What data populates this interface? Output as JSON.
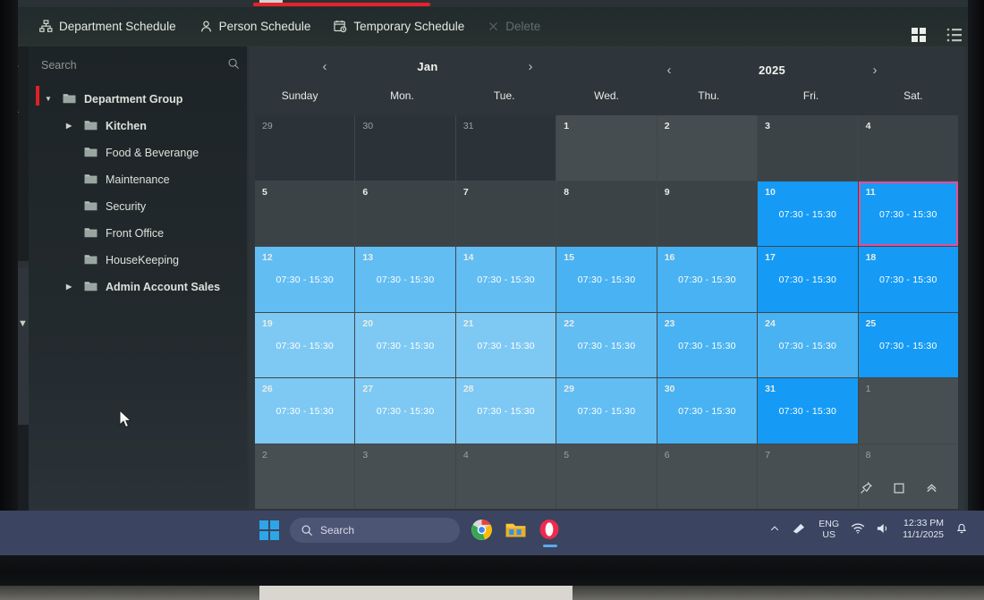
{
  "app": {
    "tabs": [
      {
        "label": "Department Schedule",
        "icon": "org-chart-icon",
        "state": "active"
      },
      {
        "label": "Person Schedule",
        "icon": "person-icon",
        "state": "normal"
      },
      {
        "label": "Temporary Schedule",
        "icon": "calendar-clock-icon",
        "state": "normal"
      },
      {
        "label": "Delete",
        "icon": "close-x-icon",
        "state": "disabled"
      }
    ],
    "view_toggles": [
      {
        "name": "grid-view-icon",
        "active": true
      },
      {
        "name": "list-view-icon",
        "active": false
      }
    ]
  },
  "sidebar": {
    "search": {
      "placeholder": "Search",
      "value": "",
      "icon": "search-icon"
    },
    "tree": [
      {
        "label": "Department Group",
        "level": 0,
        "expanded": true,
        "bold": true,
        "selected": true
      },
      {
        "label": "Kitchen",
        "level": 1,
        "expanded": false,
        "bold": true,
        "selected": false
      },
      {
        "label": "Food & Beverange",
        "level": 1,
        "expanded": null,
        "bold": false,
        "selected": false
      },
      {
        "label": "Maintenance",
        "level": 1,
        "expanded": null,
        "bold": false,
        "selected": false
      },
      {
        "label": "Security",
        "level": 1,
        "expanded": null,
        "bold": false,
        "selected": false
      },
      {
        "label": "Front Office",
        "level": 1,
        "expanded": null,
        "bold": false,
        "selected": false
      },
      {
        "label": "HouseKeeping",
        "level": 1,
        "expanded": null,
        "bold": false,
        "selected": false
      },
      {
        "label": "Admin Account Sales",
        "level": 1,
        "expanded": false,
        "bold": true,
        "selected": false
      }
    ]
  },
  "calendar": {
    "month": "Jan",
    "year": "2025",
    "prev_chevron": "‹",
    "next_chevron": "›",
    "day_headers": [
      "Sunday",
      "Mon.",
      "Tue.",
      "Wed.",
      "Thu.",
      "Fri.",
      "Sat."
    ],
    "shift_label": "07:30 - 15:30",
    "selected_day": 11,
    "accent_blue": "#159bf5",
    "selection_pink": "#ea4c96",
    "weeks": [
      [
        {
          "day": "29",
          "shift": "",
          "tone": "t-prev",
          "muted": true
        },
        {
          "day": "30",
          "shift": "",
          "tone": "t-prev",
          "muted": true
        },
        {
          "day": "31",
          "shift": "",
          "tone": "t-prev",
          "muted": true
        },
        {
          "day": "1",
          "shift": "",
          "tone": "t-empty2",
          "muted": false
        },
        {
          "day": "2",
          "shift": "",
          "tone": "t-empty2",
          "muted": false
        },
        {
          "day": "3",
          "shift": "",
          "tone": "t-empty",
          "muted": false
        },
        {
          "day": "4",
          "shift": "",
          "tone": "t-empty",
          "muted": false
        }
      ],
      [
        {
          "day": "5",
          "shift": "",
          "tone": "t-empty",
          "muted": false
        },
        {
          "day": "6",
          "shift": "",
          "tone": "t-empty",
          "muted": false
        },
        {
          "day": "7",
          "shift": "",
          "tone": "t-empty",
          "muted": false
        },
        {
          "day": "8",
          "shift": "",
          "tone": "t-empty",
          "muted": false
        },
        {
          "day": "9",
          "shift": "",
          "tone": "t-empty",
          "muted": false
        },
        {
          "day": "10",
          "shift": "07:30 - 15:30",
          "tone": "t-blue",
          "muted": false
        },
        {
          "day": "11",
          "shift": "07:30 - 15:30",
          "tone": "t-blue",
          "muted": false,
          "selected": true
        }
      ],
      [
        {
          "day": "12",
          "shift": "07:30 - 15:30",
          "tone": "t-blue-l2",
          "muted": false
        },
        {
          "day": "13",
          "shift": "07:30 - 15:30",
          "tone": "t-blue-l2",
          "muted": false
        },
        {
          "day": "14",
          "shift": "07:30 - 15:30",
          "tone": "t-blue-l2",
          "muted": false
        },
        {
          "day": "15",
          "shift": "07:30 - 15:30",
          "tone": "t-blue-l",
          "muted": false
        },
        {
          "day": "16",
          "shift": "07:30 - 15:30",
          "tone": "t-blue-l",
          "muted": false
        },
        {
          "day": "17",
          "shift": "07:30 - 15:30",
          "tone": "t-blue",
          "muted": false
        },
        {
          "day": "18",
          "shift": "07:30 - 15:30",
          "tone": "t-blue",
          "muted": false
        }
      ],
      [
        {
          "day": "19",
          "shift": "07:30 - 15:30",
          "tone": "t-blue-l3",
          "muted": false
        },
        {
          "day": "20",
          "shift": "07:30 - 15:30",
          "tone": "t-blue-l3",
          "muted": false
        },
        {
          "day": "21",
          "shift": "07:30 - 15:30",
          "tone": "t-blue-l3",
          "muted": false
        },
        {
          "day": "22",
          "shift": "07:30 - 15:30",
          "tone": "t-blue-l2",
          "muted": false
        },
        {
          "day": "23",
          "shift": "07:30 - 15:30",
          "tone": "t-blue-l",
          "muted": false
        },
        {
          "day": "24",
          "shift": "07:30 - 15:30",
          "tone": "t-blue-l",
          "muted": false
        },
        {
          "day": "25",
          "shift": "07:30 - 15:30",
          "tone": "t-blue",
          "muted": false
        }
      ],
      [
        {
          "day": "26",
          "shift": "07:30 - 15:30",
          "tone": "t-blue-l3",
          "muted": false
        },
        {
          "day": "27",
          "shift": "07:30 - 15:30",
          "tone": "t-blue-l3",
          "muted": false
        },
        {
          "day": "28",
          "shift": "07:30 - 15:30",
          "tone": "t-blue-l3",
          "muted": false
        },
        {
          "day": "29",
          "shift": "07:30 - 15:30",
          "tone": "t-blue-l2",
          "muted": false
        },
        {
          "day": "30",
          "shift": "07:30 - 15:30",
          "tone": "t-blue-l",
          "muted": false
        },
        {
          "day": "31",
          "shift": "07:30 - 15:30",
          "tone": "t-blue",
          "muted": false
        },
        {
          "day": "1",
          "shift": "",
          "tone": "t-next",
          "muted": true
        }
      ],
      [
        {
          "day": "2",
          "shift": "",
          "tone": "t-next",
          "muted": true
        },
        {
          "day": "3",
          "shift": "",
          "tone": "t-next",
          "muted": true
        },
        {
          "day": "4",
          "shift": "",
          "tone": "t-next",
          "muted": true
        },
        {
          "day": "5",
          "shift": "",
          "tone": "t-next",
          "muted": true
        },
        {
          "day": "6",
          "shift": "",
          "tone": "t-next",
          "muted": true
        },
        {
          "day": "7",
          "shift": "",
          "tone": "t-next",
          "muted": true
        },
        {
          "day": "8",
          "shift": "",
          "tone": "t-next",
          "muted": true
        }
      ]
    ]
  },
  "window_controls": [
    {
      "name": "pin-icon",
      "glyph": "📌"
    },
    {
      "name": "maximize-icon",
      "glyph": "□"
    },
    {
      "name": "collapse-up-icon",
      "glyph": "⌃"
    }
  ],
  "taskbar": {
    "start": "start-icon",
    "search_placeholder": "Search",
    "apps": [
      {
        "name": "chrome-icon"
      },
      {
        "name": "file-explorer-icon"
      },
      {
        "name": "opera-icon",
        "active": true
      }
    ],
    "tray": {
      "overflow": "⌃",
      "language_top": "ENG",
      "language_bottom": "US",
      "time": "12:33 PM",
      "date": "11/1/2025"
    }
  }
}
